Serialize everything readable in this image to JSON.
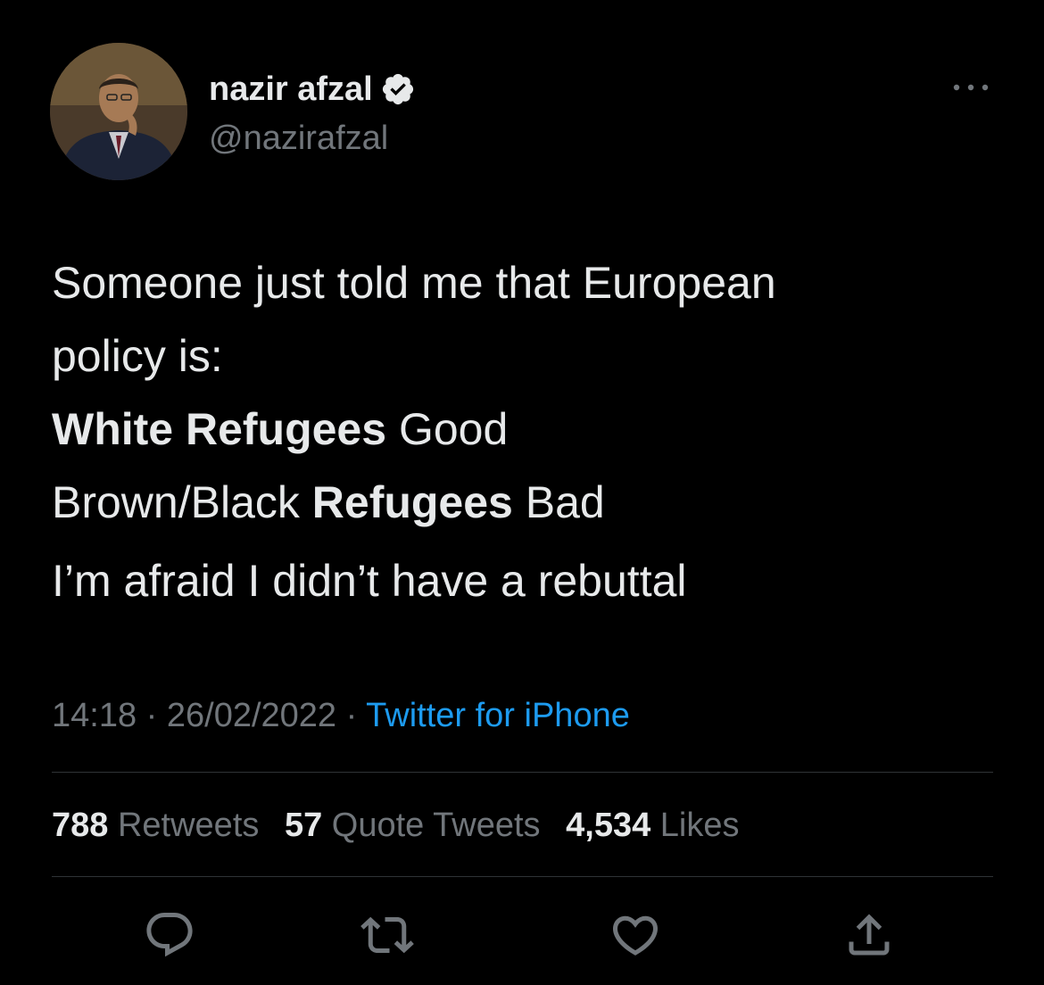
{
  "author": {
    "display_name": "nazir afzal",
    "handle": "@nazirafzal",
    "verified_icon": "verified-badge-icon",
    "avatar": "avatar-photo"
  },
  "tweet": {
    "lines": [
      [
        {
          "text": "Someone just told me that European",
          "bold": false
        }
      ],
      [
        {
          "text": "policy is:",
          "bold": false
        }
      ],
      [
        {
          "text": "White Refugees",
          "bold": true
        },
        {
          "text": " Good",
          "bold": false
        }
      ],
      [
        {
          "text": "Brown/Black ",
          "bold": false
        },
        {
          "text": "Refugees",
          "bold": true
        },
        {
          "text": " Bad",
          "bold": false
        }
      ],
      [
        {
          "text": "I’m afraid I didn’t have a rebuttal",
          "bold": false
        }
      ]
    ]
  },
  "meta": {
    "time": "14:18",
    "separator": " · ",
    "date": "26/02/2022",
    "source": "Twitter for iPhone"
  },
  "stats": {
    "retweets_count": "788",
    "retweets_label": "Retweets",
    "quotes_count": "57",
    "quotes_label": "Quote Tweets",
    "likes_count": "4,534",
    "likes_label": "Likes"
  },
  "actions": [
    "reply-icon",
    "retweet-icon",
    "like-icon",
    "share-icon"
  ],
  "colors": {
    "background": "#000000",
    "text": "#e7e9ea",
    "secondary": "#71767b",
    "link": "#1d9bf0",
    "divider": "#2f3336"
  }
}
